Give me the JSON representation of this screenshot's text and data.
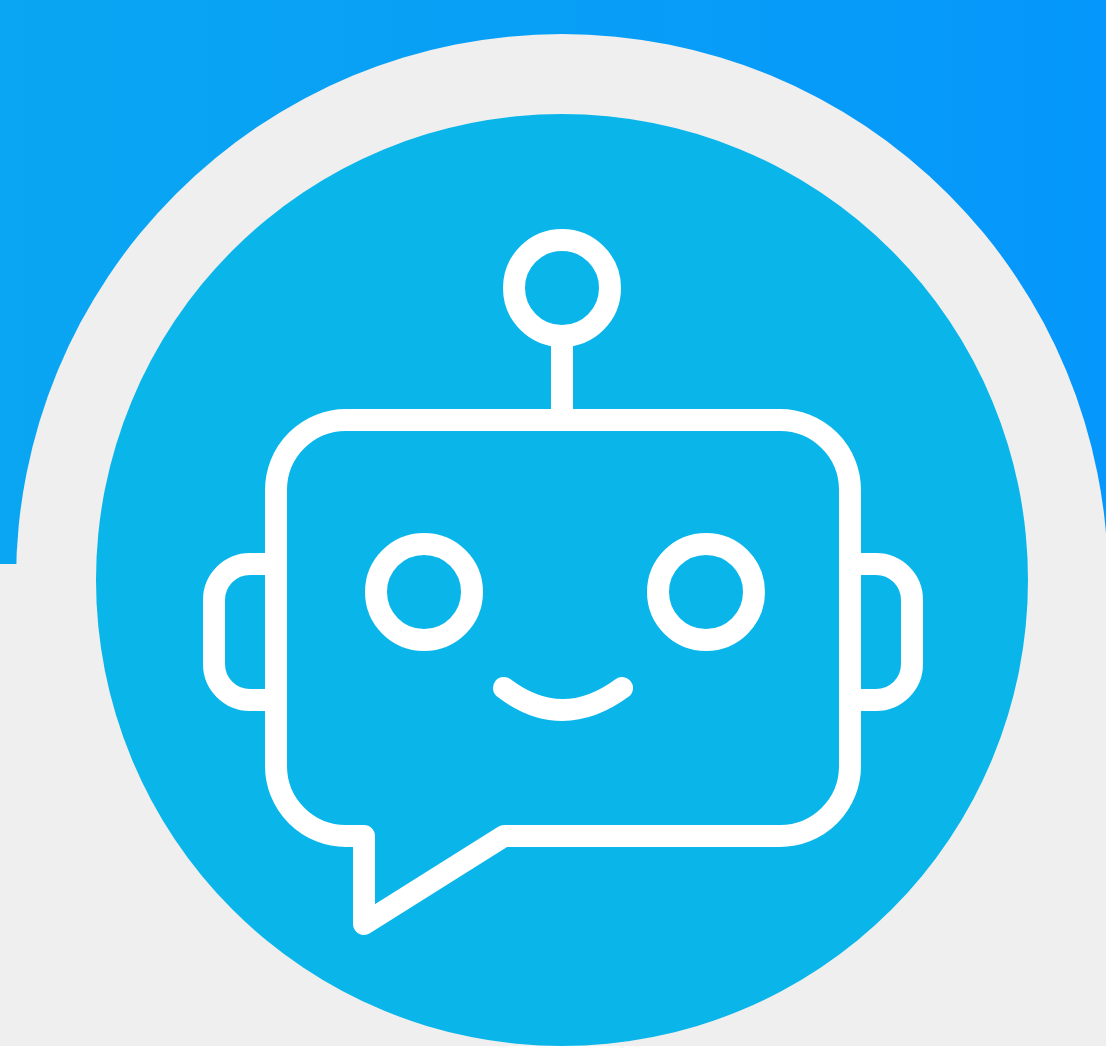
{
  "avatar": {
    "kind": "robot"
  }
}
